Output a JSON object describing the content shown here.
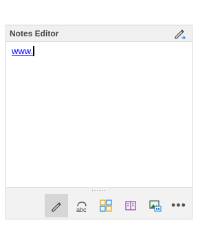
{
  "header": {
    "title": "Notes Editor"
  },
  "editor": {
    "text": "www."
  },
  "grip": {
    "dots": "······"
  },
  "toolbar": {
    "buttons": [
      {
        "icon": "pen-icon",
        "active": true
      },
      {
        "icon": "cloud-abc-icon",
        "label": "abc"
      },
      {
        "icon": "grid-icon"
      },
      {
        "icon": "book-icon"
      },
      {
        "icon": "image-gallery-icon"
      },
      {
        "icon": "more-icon",
        "label": "•••"
      }
    ]
  },
  "colors": {
    "accent": "#0078d4",
    "link": "#0000ee",
    "toolbar_bg": "#f2f2f2"
  }
}
